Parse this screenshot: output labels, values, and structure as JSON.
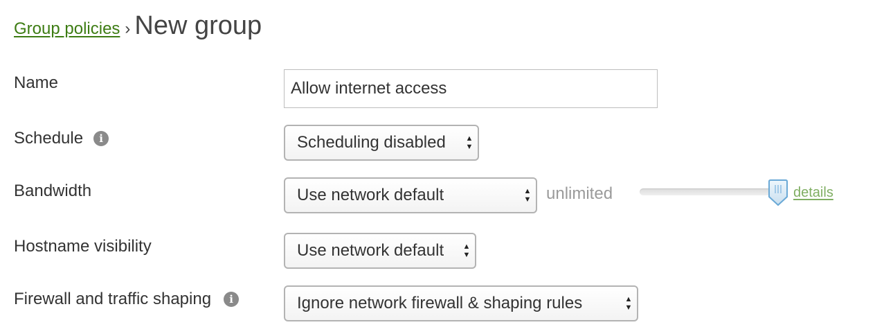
{
  "breadcrumb": {
    "parent_label": "Group policies",
    "separator": "›",
    "current_title": "New group"
  },
  "form": {
    "name": {
      "label": "Name",
      "value": "Allow internet access"
    },
    "schedule": {
      "label": "Schedule",
      "info_icon": "info-icon",
      "selected": "Scheduling disabled"
    },
    "bandwidth": {
      "label": "Bandwidth",
      "selected": "Use network default",
      "status": "unlimited",
      "slider_level": 1.0,
      "details_label": "details"
    },
    "hostname_visibility": {
      "label": "Hostname visibility",
      "selected": "Use network default"
    },
    "firewall": {
      "label": "Firewall and traffic shaping",
      "info_icon": "info-icon",
      "selected": "Ignore network firewall & shaping rules"
    }
  },
  "select_arrows": {
    "up": "▲",
    "down": "▼"
  },
  "colors": {
    "link": "#3d7c13",
    "details_link": "#7fae62",
    "muted_text": "#9a9a9a",
    "slider_handle": "#6aa9d6"
  }
}
